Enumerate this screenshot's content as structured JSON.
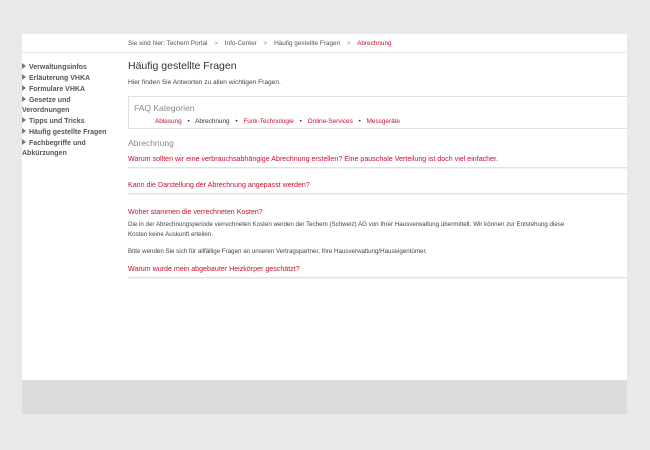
{
  "breadcrumb": {
    "prefix": "Sie sind hier:",
    "items": [
      "Techem Portal",
      "Info-Center",
      "Häufig gestellte Fragen"
    ],
    "current": "Abrechnung"
  },
  "sidebar": {
    "items": [
      {
        "label": "Verwaltungsinfos"
      },
      {
        "label": "Erläuterung VHKA"
      },
      {
        "label": "Formulare VHKA"
      },
      {
        "label": "Gesetze und Verordnungen"
      },
      {
        "label": "Tipps und Tricks"
      },
      {
        "label": "Häufig gestellte Fragen"
      },
      {
        "label": "Fachbegriffe und Abkürzungen"
      }
    ]
  },
  "main": {
    "title": "Häufig gestellte Fragen",
    "intro": "Hier finden Sie Antworten zu allen wichtigen Fragen.",
    "faq": {
      "title": "FAQ Kategorien",
      "categories": [
        "Ablesung",
        "Abrechnung",
        "Funk-Technologie",
        "Online-Services",
        "Messgeräte"
      ],
      "active": "Abrechnung"
    },
    "section_title": "Abrechnung",
    "questions": [
      {
        "text": "Warum sollten wir eine verbrauchsabhängige Abrechnung erstellen? Eine pauschale Verteilung ist doch viel einfacher."
      },
      {
        "text": "Kann die Darstellung der Abrechnung angepasst werden?"
      },
      {
        "text": "Woher stammen die verrechneten Kosten?",
        "answer_line1": "Die in der Abrechnungsperiode verrechneten Kosten werden der Techem (Schweiz) AG von Ihrer Hausverwaltung übermittelt. Wir können zur Entstehung diese",
        "answer_line2": "Kosten keine Auskunft erteilen.",
        "answer_para2": "Bitte wenden Sie sich für allfällige Fragen an unseren Vertragspartner, Ihre Hausverwaltung/Hauseigentümer."
      },
      {
        "text": "Warum wurde mein abgebauter Heizkörper geschätzt?"
      }
    ]
  }
}
